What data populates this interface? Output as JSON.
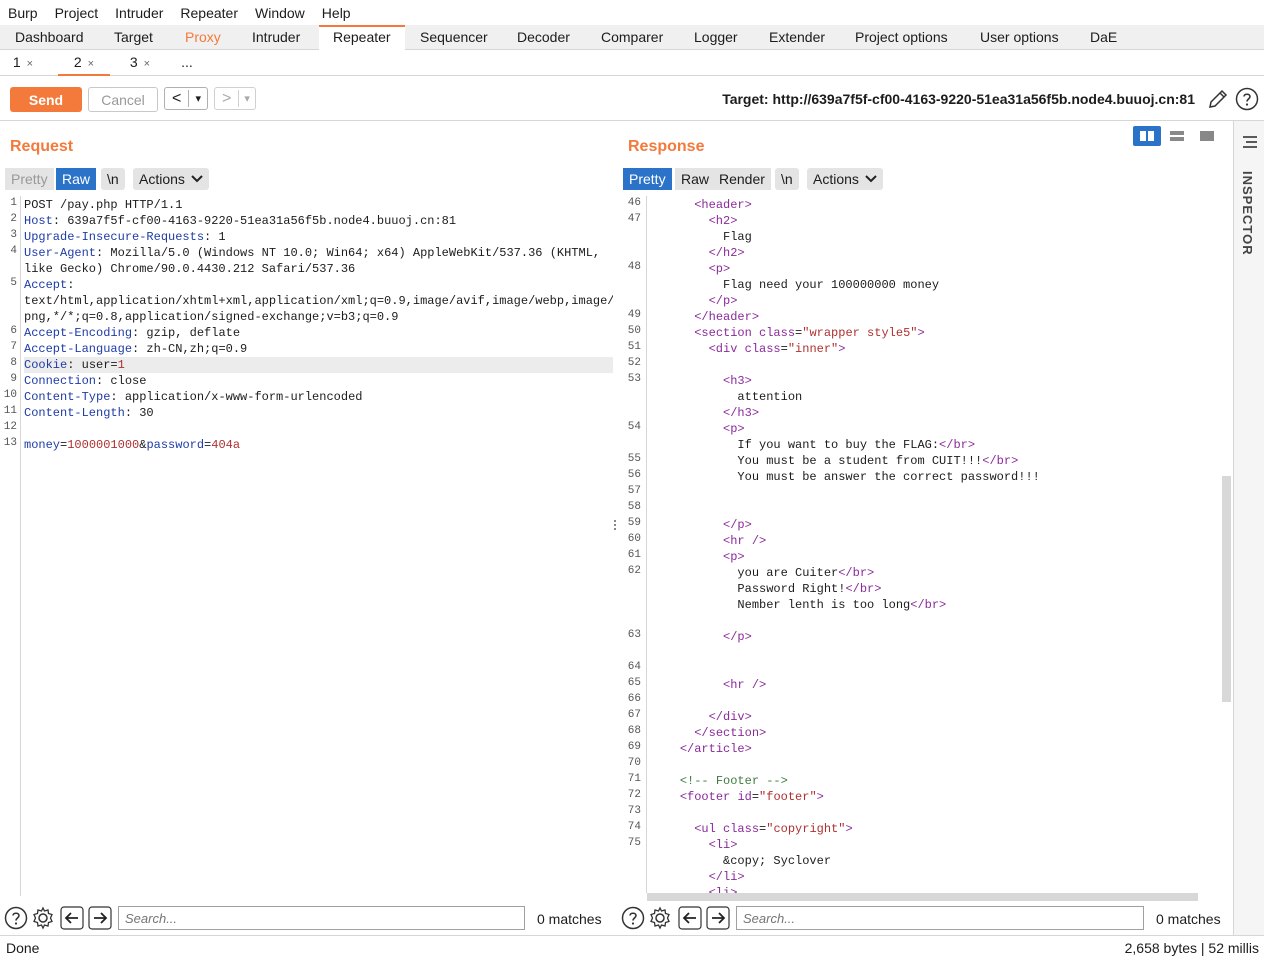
{
  "menu": [
    "Burp",
    "Project",
    "Intruder",
    "Repeater",
    "Window",
    "Help"
  ],
  "main_tabs": [
    "Dashboard",
    "Target",
    "Proxy",
    "Intruder",
    "Repeater",
    "Sequencer",
    "Decoder",
    "Comparer",
    "Logger",
    "Extender",
    "Project options",
    "User options",
    "DaE"
  ],
  "active_main_tab": "Repeater",
  "sub_tabs": [
    "1",
    "2",
    "3",
    "..."
  ],
  "sub_tab_close": "×",
  "toolbar": {
    "send_label": "Send",
    "cancel_label": "Cancel",
    "back_glyph": "<",
    "forward_glyph": ">",
    "dropdown_glyph": "▾",
    "target": "Target: http://639a7f5f-cf00-4163-9220-51ea31a56f5b.node4.buuoj.cn:81"
  },
  "request": {
    "title": "Request",
    "buttons": {
      "pretty": "Pretty",
      "raw": "Raw",
      "newline": "\\n",
      "actions": "Actions"
    },
    "lines": [
      {
        "n": "1",
        "text": "POST /pay.php HTTP/1.1"
      },
      {
        "n": "2",
        "key": "Host",
        "val": " 639a7f5f-cf00-4163-9220-51ea31a56f5b.node4.buuoj.cn:81"
      },
      {
        "n": "3",
        "key": "Upgrade-Insecure-Requests",
        "val": " 1"
      },
      {
        "n": "4",
        "key": "User-Agent",
        "val": " Mozilla/5.0 (Windows NT 10.0; Win64; x64) AppleWebKit/537.36 (KHTML,"
      },
      {
        "n": "",
        "text": "like Gecko) Chrome/90.0.4430.212 Safari/537.36"
      },
      {
        "n": "5",
        "key": "Accept",
        "val": ""
      },
      {
        "n": "",
        "text": "text/html,application/xhtml+xml,application/xml;q=0.9,image/avif,image/webp,image/a"
      },
      {
        "n": "",
        "text": "png,*/*;q=0.8,application/signed-exchange;v=b3;q=0.9"
      },
      {
        "n": "6",
        "key": "Accept-Encoding",
        "val": " gzip, deflate"
      },
      {
        "n": "7",
        "key": "Accept-Language",
        "val": " zh-CN,zh;q=0.9"
      },
      {
        "n": "8",
        "key": "Cookie",
        "val": " user=",
        "val2": "1"
      },
      {
        "n": "9",
        "key": "Connection",
        "val": " close"
      },
      {
        "n": "10",
        "key": "Content-Type",
        "val": " application/x-www-form-urlencoded"
      },
      {
        "n": "11",
        "key": "Content-Length",
        "val": " 30"
      },
      {
        "n": "12",
        "text": ""
      },
      {
        "n": "13",
        "body": [
          "money",
          "=",
          "1000001000",
          "&",
          "password",
          "=",
          "404a"
        ]
      }
    ],
    "search_placeholder": "Search...",
    "matches": "0 matches"
  },
  "response": {
    "title": "Response",
    "buttons": {
      "pretty": "Pretty",
      "raw": "Raw",
      "render": "Render",
      "newline": "\\n",
      "actions": "Actions"
    },
    "lines": [
      {
        "n": "46",
        "html": "      <t>&lt;header&gt;</t>"
      },
      {
        "n": "47",
        "html": "        <t>&lt;h2&gt;</t>"
      },
      {
        "n": "",
        "html": "          Flag"
      },
      {
        "n": "",
        "html": "        <t>&lt;/h2&gt;</t>"
      },
      {
        "n": "48",
        "html": "        <t>&lt;p&gt;</t>"
      },
      {
        "n": "",
        "html": "          Flag need your 100000000 money"
      },
      {
        "n": "",
        "html": "        <t>&lt;/p&gt;</t>"
      },
      {
        "n": "49",
        "html": "      <t>&lt;/header&gt;</t>"
      },
      {
        "n": "50",
        "html": "      <t>&lt;section</t> <a>class</a>=<v>\"wrapper style5\"</v><t>&gt;</t>"
      },
      {
        "n": "51",
        "html": "        <t>&lt;div</t> <a>class</a>=<v>\"inner\"</v><t>&gt;</t>"
      },
      {
        "n": "52",
        "html": ""
      },
      {
        "n": "53",
        "html": "          <t>&lt;h3&gt;</t>"
      },
      {
        "n": "",
        "html": "            attention"
      },
      {
        "n": "",
        "html": "          <t>&lt;/h3&gt;</t>"
      },
      {
        "n": "54",
        "html": "          <t>&lt;p&gt;</t>"
      },
      {
        "n": "",
        "html": "            If you want to buy the FLAG:<t>&lt;/br&gt;</t>"
      },
      {
        "n": "55",
        "html": "            You must be a student from CUIT!!!<t>&lt;/br&gt;</t>"
      },
      {
        "n": "56",
        "html": "            You must be answer the correct password!!!"
      },
      {
        "n": "57",
        "html": ""
      },
      {
        "n": "58",
        "html": ""
      },
      {
        "n": "59",
        "html": "          <t>&lt;/p&gt;</t>"
      },
      {
        "n": "60",
        "html": "          <t>&lt;hr /&gt;</t>"
      },
      {
        "n": "61",
        "html": "          <t>&lt;p&gt;</t>"
      },
      {
        "n": "62",
        "html": "            you are Cuiter<t>&lt;/br&gt;</t>"
      },
      {
        "n": "",
        "html": "            Password Right!<t>&lt;/br&gt;</t>"
      },
      {
        "n": "",
        "html": "            Nember lenth is too long<t>&lt;/br&gt;</t>"
      },
      {
        "n": "",
        "html": ""
      },
      {
        "n": "63",
        "html": "          <t>&lt;/p&gt;</t>"
      },
      {
        "n": "",
        "html": ""
      },
      {
        "n": "64",
        "html": ""
      },
      {
        "n": "65",
        "html": "          <t>&lt;hr /&gt;</t>"
      },
      {
        "n": "66",
        "html": ""
      },
      {
        "n": "67",
        "html": "        <t>&lt;/div&gt;</t>"
      },
      {
        "n": "68",
        "html": "      <t>&lt;/section&gt;</t>"
      },
      {
        "n": "69",
        "html": "    <t>&lt;/article&gt;</t>"
      },
      {
        "n": "70",
        "html": ""
      },
      {
        "n": "71",
        "html": "    <c>&lt;!-- Footer --&gt;</c>"
      },
      {
        "n": "72",
        "html": "    <t>&lt;footer</t> <a>id</a>=<v>\"footer\"</v><t>&gt;</t>"
      },
      {
        "n": "73",
        "html": ""
      },
      {
        "n": "74",
        "html": "      <t>&lt;ul</t> <a>class</a>=<v>\"copyright\"</v><t>&gt;</t>"
      },
      {
        "n": "75",
        "html": "        <t>&lt;li&gt;</t>"
      },
      {
        "n": "",
        "html": "          &amp;copy; Syclover"
      },
      {
        "n": "",
        "html": "        <t>&lt;/li&gt;</t>"
      },
      {
        "n": "",
        "html": "        <t>&lt;li&gt;</t>"
      }
    ],
    "search_placeholder": "Search...",
    "matches": "0 matches"
  },
  "inspector_label": "INSPECTOR",
  "status": {
    "left": "Done",
    "right": "2,658 bytes | 52 millis"
  },
  "colors": {
    "accent": "#f37a3b",
    "active_button": "#2b73c8",
    "header_key": "#1e3ca8",
    "tag": "#8a2b9a",
    "value": "#b03030"
  }
}
